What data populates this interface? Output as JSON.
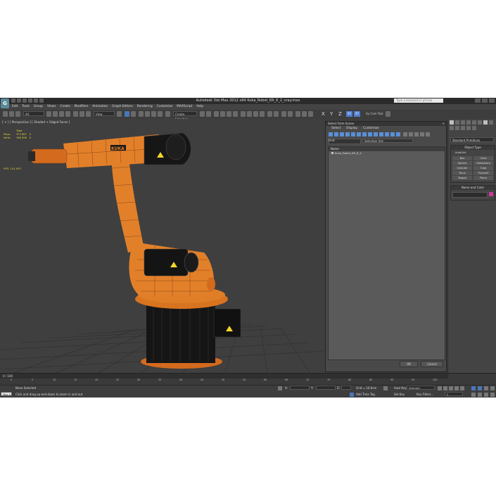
{
  "app": {
    "title": "Autodesk 3ds Max  2012 x64    Kuka_Robot_KR_6_2_vray.max",
    "search_placeholder": "Type a keyword or phrase",
    "logo": "3ds-max-logo-icon"
  },
  "menu": [
    "Edit",
    "Tools",
    "Group",
    "Views",
    "Create",
    "Modifiers",
    "Animation",
    "Graph Editors",
    "Rendering",
    "Customize",
    "MAXScript",
    "Help"
  ],
  "toolbar": {
    "filter_value": "All",
    "view_value": "View",
    "selection_set_placeholder": "Create Selection",
    "axes": [
      "X",
      "Y",
      "Z",
      "XY",
      "XY"
    ],
    "cam_tool": "ity Cam Tool"
  },
  "viewport": {
    "label": "[ + ] [ Perspective ] [ Shaded + Edged Faces ]",
    "stats": {
      "total_label": "Total",
      "polys_label": "Polys:",
      "polys_value": "372 887",
      "polys_sel": "0",
      "verts_label": "Verts:",
      "verts_value": "188 996",
      "verts_sel": "0"
    },
    "fps_label": "FPS:",
    "fps_value": "141.097",
    "model_brand": "KUKA"
  },
  "dialog": {
    "title": "Select From Scene",
    "menu": [
      "Select",
      "Display",
      "Customize"
    ],
    "find_label": "Find:",
    "selection_set": "Selection Set:",
    "column": "Name",
    "rows": [
      "Kuka_Robot_KR_6_2"
    ],
    "ok": "OK",
    "cancel": "Cancel"
  },
  "command_panel": {
    "dropdown": "Standard Primitives",
    "object_type_header": "Object Type",
    "autogrid": "AutoGrid",
    "buttons": [
      "Box",
      "Cone",
      "Sphere",
      "GeoSphere",
      "Cylinder",
      "Tube",
      "Torus",
      "Pyramid",
      "Teapot",
      "Plane"
    ],
    "name_color_header": "Name and Color",
    "object_color": "#c83a9a"
  },
  "timeline": {
    "frame_label": "0 / 100",
    "ticks": [
      "0",
      "5",
      "10",
      "15",
      "20",
      "25",
      "30",
      "35",
      "40",
      "45",
      "50",
      "55",
      "60",
      "65",
      "70",
      "75",
      "80",
      "85",
      "90",
      "95",
      "100"
    ]
  },
  "status": {
    "script_field": "Max b",
    "none_selected": "None Selected",
    "prompt": "Click and drag up-and-down to zoom in and out",
    "x_label": "X:",
    "y_label": "Y:",
    "z_label": "Z:",
    "grid": "Grid = 10,0cm",
    "auto_key": "Auto Key",
    "selected": "Selected",
    "set_key": "Set Key",
    "key_filters": "Key Filters...",
    "add_time_tag": "Add Time Tag",
    "frame": "0"
  }
}
